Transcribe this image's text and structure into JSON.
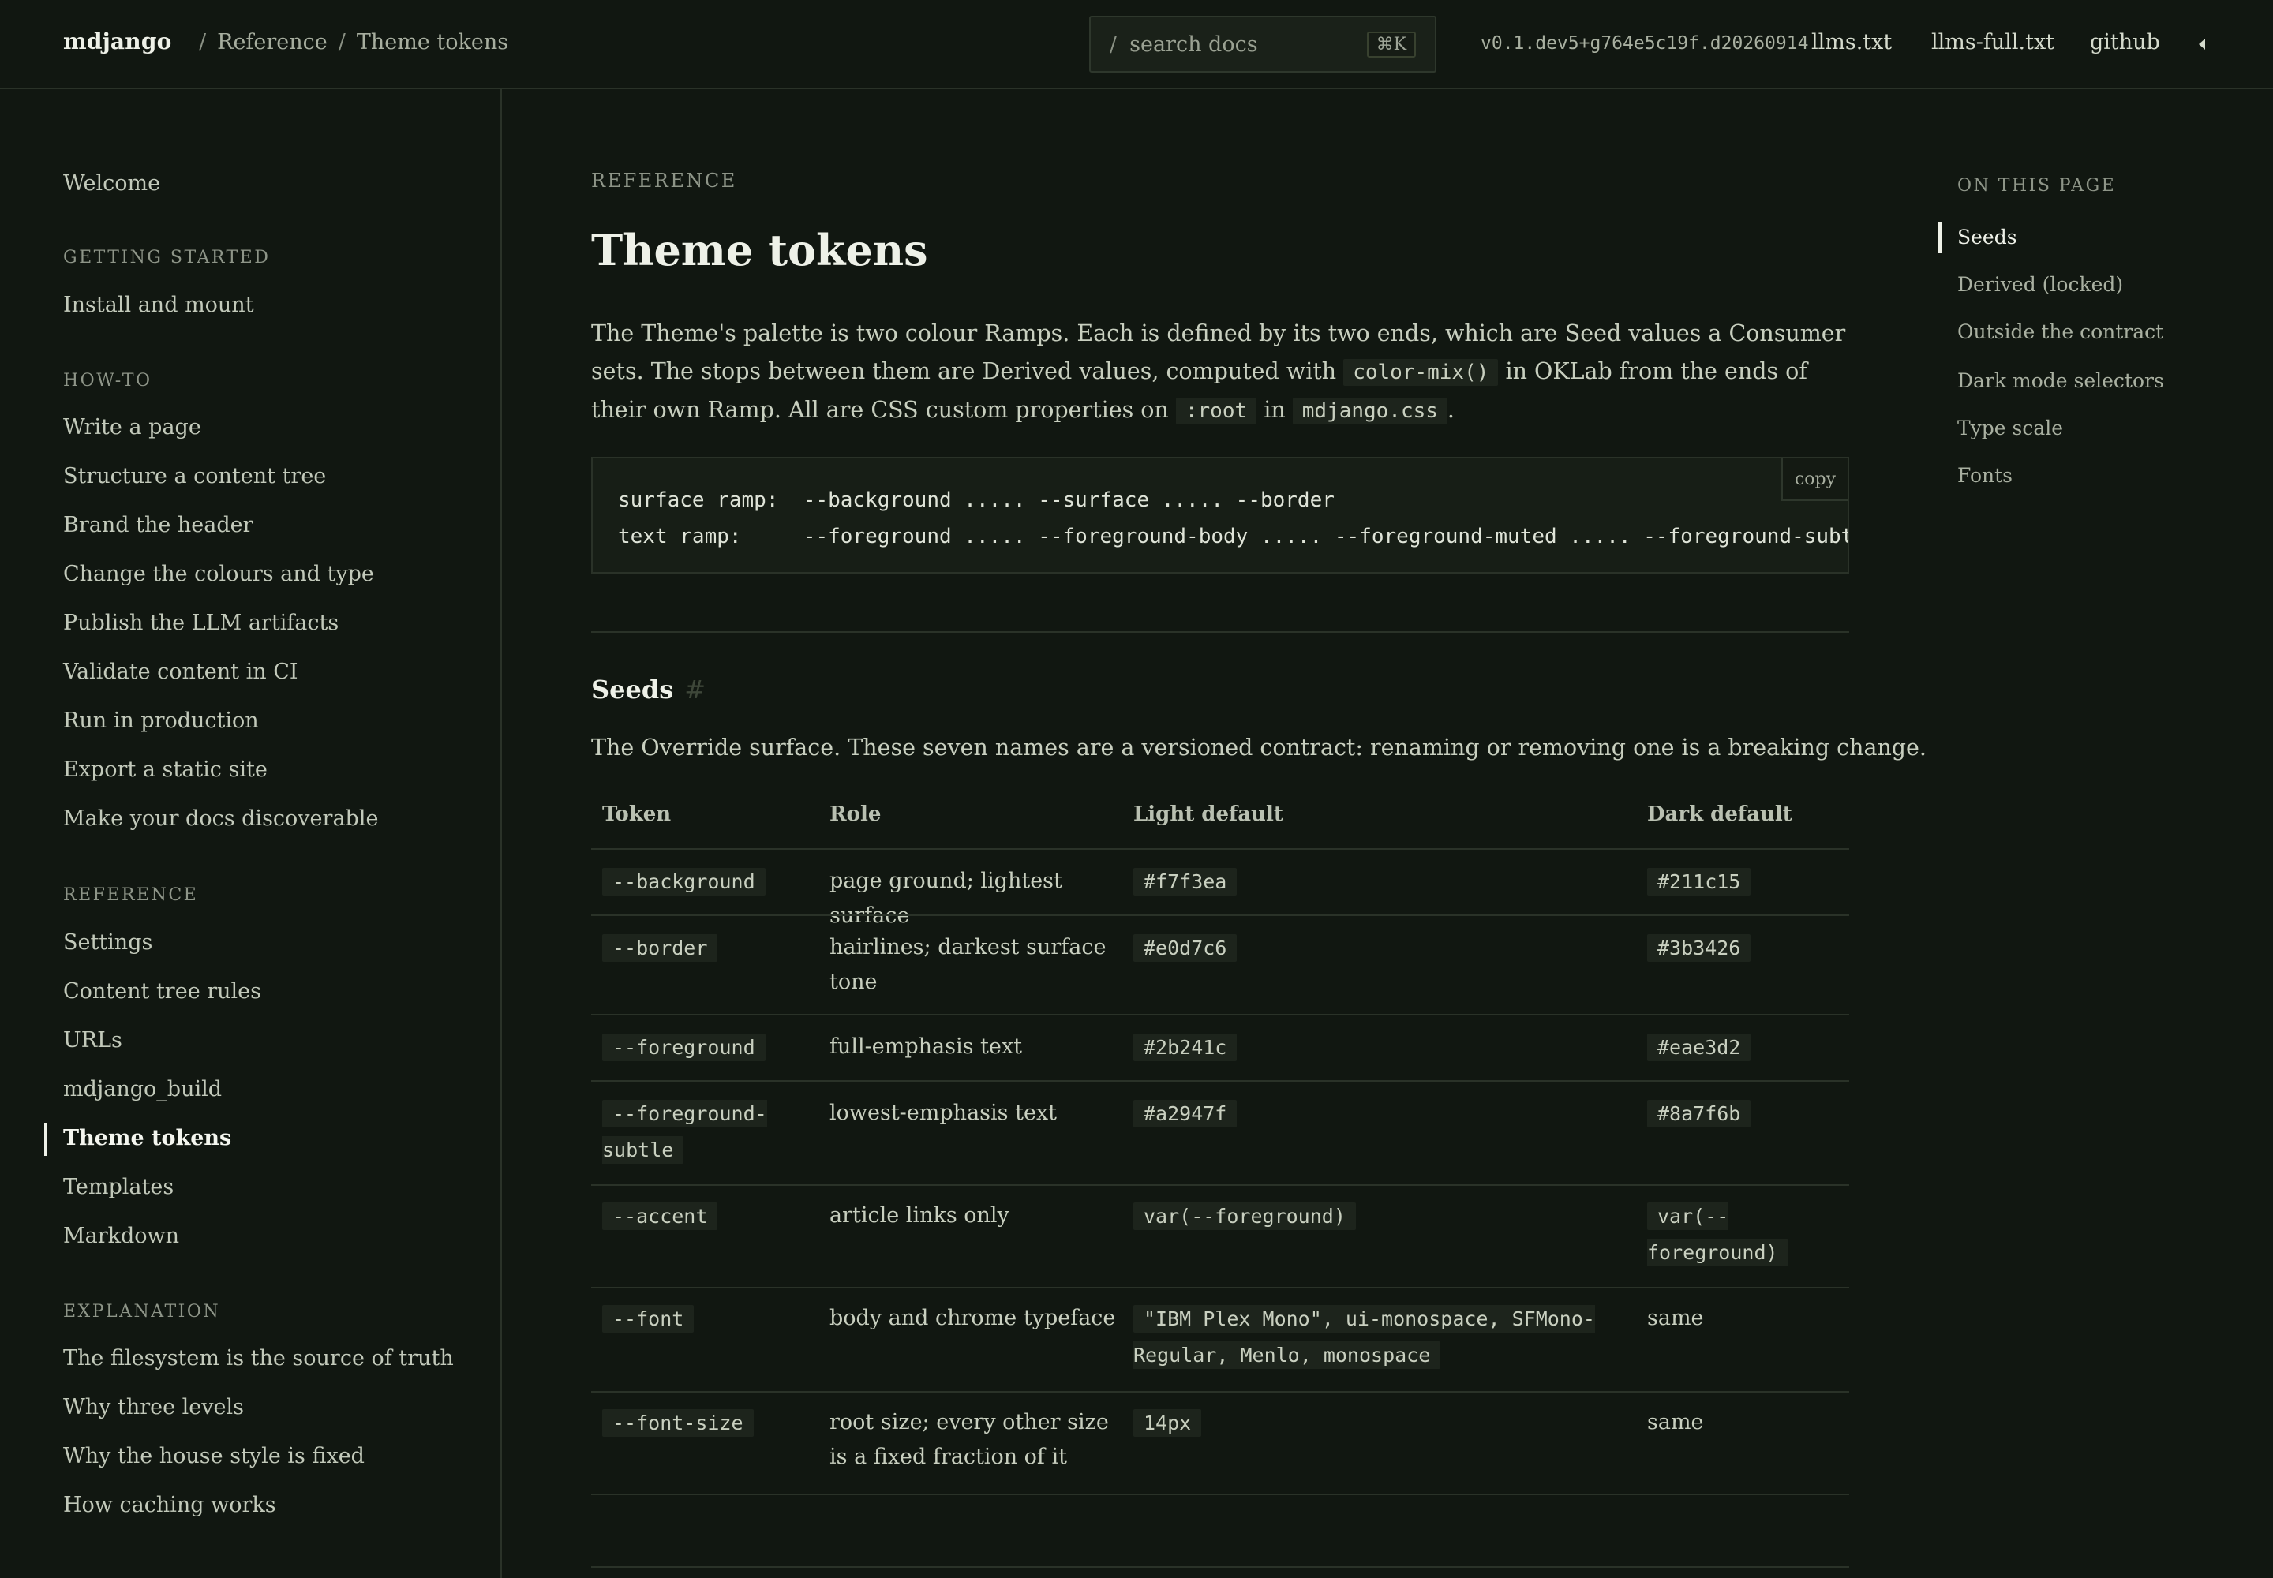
{
  "header": {
    "brand": "mdjango",
    "breadcrumb": [
      "Reference",
      "Theme tokens"
    ],
    "breadcrumb_sep": "/",
    "search": {
      "slash": "/",
      "placeholder": "search docs",
      "shortcut": "⌘K"
    },
    "version": "v0.1.dev5+g764e5c19f.d20260914",
    "links": [
      "llms.txt",
      "llms-full.txt",
      "github"
    ],
    "theme_toggle_icon": "caret-left-icon"
  },
  "sidebar": {
    "welcome": "Welcome",
    "sections": [
      {
        "heading": "GETTING STARTED",
        "items": [
          "Install and mount"
        ]
      },
      {
        "heading": "HOW-TO",
        "items": [
          "Write a page",
          "Structure a content tree",
          "Brand the header",
          "Change the colours and type",
          "Publish the LLM artifacts",
          "Validate content in CI",
          "Run in production",
          "Export a static site",
          "Make your docs discoverable"
        ]
      },
      {
        "heading": "REFERENCE",
        "items": [
          "Settings",
          "Content tree rules",
          "URLs",
          "mdjango_build",
          "Theme tokens",
          "Templates",
          "Markdown"
        ]
      },
      {
        "heading": "EXPLANATION",
        "items": [
          "The filesystem is the source of truth",
          "Why three levels",
          "Why the house style is fixed",
          "How caching works"
        ]
      }
    ],
    "active": "Theme tokens"
  },
  "main": {
    "eyebrow": "REFERENCE",
    "title": "Theme tokens",
    "intro": {
      "p1": "The Theme's palette is two colour Ramps. Each is defined by its two ends, which are Seed values a Consumer sets. The stops between them are Derived values, computed with ",
      "code1": "color-mix()",
      "p2": " in OKLab from the ends of their own Ramp. All are CSS custom properties on ",
      "code2": ":root",
      "p3": " in ",
      "code3": "mdjango.css",
      "p4": "."
    },
    "codeblock": {
      "line1": "surface ramp:  --background ..... --surface ..... --border",
      "line2": "text ramp:     --foreground ..... --foreground-body ..... --foreground-muted ..... --foreground-subtle",
      "copy_label": "copy"
    },
    "seeds": {
      "heading": "Seeds",
      "anchor": "#",
      "description": "The Override surface. These seven names are a versioned contract: renaming or removing one is a breaking change.",
      "columns": [
        "Token",
        "Role",
        "Light default",
        "Dark default"
      ],
      "rows": [
        {
          "token": "--background",
          "role": "page ground; lightest surface",
          "light": "#f7f3ea",
          "dark": "#211c15"
        },
        {
          "token": "--border",
          "role": "hairlines; darkest surface tone",
          "light": "#e0d7c6",
          "dark": "#3b3426"
        },
        {
          "token": "--foreground",
          "role": "full-emphasis text",
          "light": "#2b241c",
          "dark": "#eae3d2"
        },
        {
          "token": "--foreground-subtle",
          "role": "lowest-emphasis text",
          "light": "#a2947f",
          "dark": "#8a7f6b"
        },
        {
          "token": "--accent",
          "role": "article links only",
          "light": "var(--foreground)",
          "dark": "var(--foreground)"
        },
        {
          "token": "--font",
          "role": "body and chrome typeface",
          "light": "\"IBM Plex Mono\", ui-monospace, SFMono-Regular, Menlo, monospace",
          "dark": "same"
        },
        {
          "token": "--font-size",
          "role": "root size; every other size is a fixed fraction of it",
          "light": "14px",
          "dark": "same"
        }
      ]
    }
  },
  "toc": {
    "heading": "ON THIS PAGE",
    "items": [
      "Seeds",
      "Derived (locked)",
      "Outside the contract",
      "Dark mode selectors",
      "Type scale",
      "Fonts"
    ],
    "active": "Seeds"
  }
}
